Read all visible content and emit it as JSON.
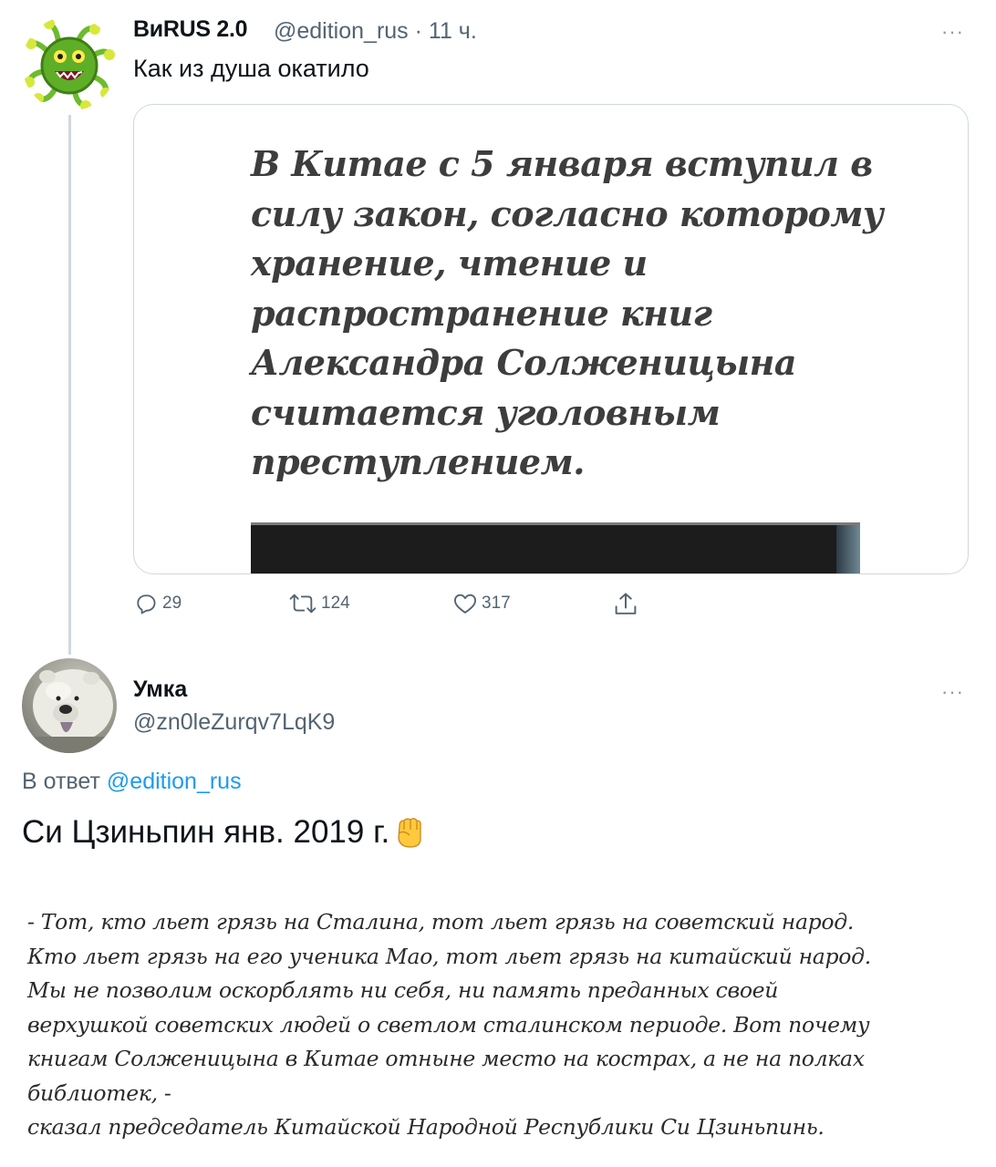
{
  "tweet1": {
    "display_name": "ВиRUS 2.0",
    "meta": "@edition_rus · 11 ч.",
    "more": "···",
    "text": "Как из душа окатило",
    "card_text": "В Китае с 5 января вступил в силу закон, согласно которому хранение, чтение и распространение книг Александра Солженицына считается уголовным преступлением.",
    "actions": {
      "replies": "29",
      "retweets": "124",
      "likes": "317"
    }
  },
  "tweet2": {
    "display_name": "Умка",
    "handle": "@zn0leZurqv7LqK9",
    "more": "···",
    "reply_prefix": "В ответ",
    "reply_handle": "@edition_rus",
    "text": "Си Цзиньпин янв. 2019 г.",
    "quote_lines": [
      "- Тот, кто льет грязь на Сталина, тот льет грязь на советский народ.",
      "Кто льет грязь на его ученика Мао, тот льет грязь на китайский народ.",
      "Мы не позволим оскорблять ни себя, ни память преданных своей",
      "верхушкой советских людей о светлом сталинском периоде. Вот почему",
      "книгам Солженицына в Китае отныне место на кострах, а не на полках",
      "библиотек, -",
      "сказал председатель Китайской Народной Республики Си Цзиньпинь."
    ]
  },
  "colors": {
    "link": "#1d9bf0",
    "secondary_text": "#536471",
    "border": "#cfd9de"
  },
  "icons": [
    "reply-icon",
    "retweet-icon",
    "like-icon",
    "share-icon",
    "more-icon",
    "fist-emoji"
  ]
}
